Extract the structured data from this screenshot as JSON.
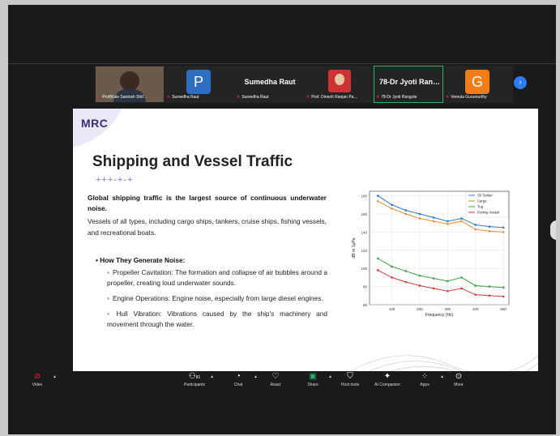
{
  "participants": [
    {
      "type": "video",
      "label": "Prof(Kale Santosh Shif…"
    },
    {
      "type": "avatar",
      "initial": "P",
      "color": "#2d6ec2",
      "label": "Sumedha Raut"
    },
    {
      "type": "name",
      "display": "Sumedha Raut",
      "label": "Sumedha Raut"
    },
    {
      "type": "photo",
      "label": "Prof. Dinesh Ranjan Pa…"
    },
    {
      "type": "name",
      "display": "78-Dr Jyoti Ran…",
      "label": "78-Dr Jyoti Rangole",
      "active": true
    },
    {
      "type": "avatar",
      "initial": "G",
      "color": "#f07d1a",
      "label": "Vemula Gurumurthy"
    }
  ],
  "next_icon": "chevron-right",
  "slide": {
    "logo": "MRC",
    "title": "Shipping and Vessel Traffic",
    "wave_glyphs": "+++-+-+",
    "lead": "Global shipping traffic is the largest source of continuous underwater noise.",
    "desc": "Vessels of all types, including cargo ships, tankers, cruise ships, fishing vessels, and recreational boats.",
    "sub": "How They Generate Noise:",
    "points": [
      "Propeller Cavitation: The formation and collapse of air bubbles around a propeller, creating loud underwater sounds.",
      "Engine Operations: Engine noise, especially from large diesel engines.",
      "Hull Vibration: Vibrations caused by the ship's machinery and movement through the water."
    ]
  },
  "chart_data": {
    "type": "line",
    "xlabel": "Frequency (Hz)",
    "ylabel": "dB re 1µPa",
    "xlim": [
      20,
      520
    ],
    "ylim": [
      60,
      185
    ],
    "xticks": [
      100,
      200,
      300,
      400,
      500
    ],
    "yticks": [
      60,
      80,
      100,
      120,
      140,
      160,
      180
    ],
    "legend_position": "top-right",
    "grid": true,
    "x": [
      50,
      100,
      150,
      200,
      250,
      300,
      350,
      400,
      450,
      500
    ],
    "series": [
      {
        "name": "Oil Tanker",
        "color": "#2a78c8",
        "values": [
          180,
          170,
          164,
          160,
          156,
          152,
          155,
          148,
          146,
          145
        ]
      },
      {
        "name": "Cargo",
        "color": "#f08c2a",
        "values": [
          174,
          166,
          160,
          155,
          152,
          149,
          152,
          143,
          141,
          140
        ]
      },
      {
        "name": "Tug",
        "color": "#3aa43a",
        "values": [
          111,
          102,
          97,
          92,
          89,
          86,
          90,
          81,
          80,
          79
        ]
      },
      {
        "name": "Fishing Vessel",
        "color": "#d33a3a",
        "values": [
          98,
          90,
          85,
          81,
          78,
          75,
          78,
          71,
          70,
          69
        ]
      }
    ]
  },
  "toolbar": {
    "video": "Video",
    "participants": "Participants",
    "participants_count": "81",
    "chat": "Chat",
    "react": "React",
    "share": "Share",
    "host_tools": "Host tools",
    "ai": "AI Companion",
    "apps": "Apps",
    "more": "More"
  }
}
